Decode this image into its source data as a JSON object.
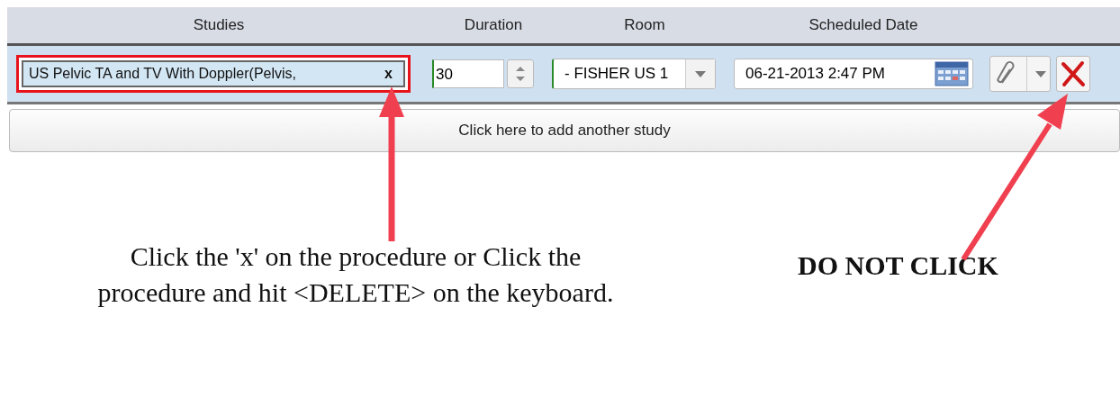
{
  "columns": [
    "Studies",
    "Duration",
    "Room",
    "Scheduled Date"
  ],
  "study": {
    "label": "US Pelvic TA and TV With Doppler(Pelvis,",
    "remove": "x",
    "selected": true
  },
  "duration": "30",
  "room": "- FISHER US 1",
  "scheduled_date": "06-21-2013 2:47 PM",
  "add_study": "Click here to add another study",
  "annotations": [
    {
      "kind": "instruction",
      "text": "Click the 'x' on the procedure or Click the procedure and hit <DELETE> on the keyboard."
    },
    {
      "kind": "warning",
      "text": "DO NOT CLICK"
    }
  ]
}
